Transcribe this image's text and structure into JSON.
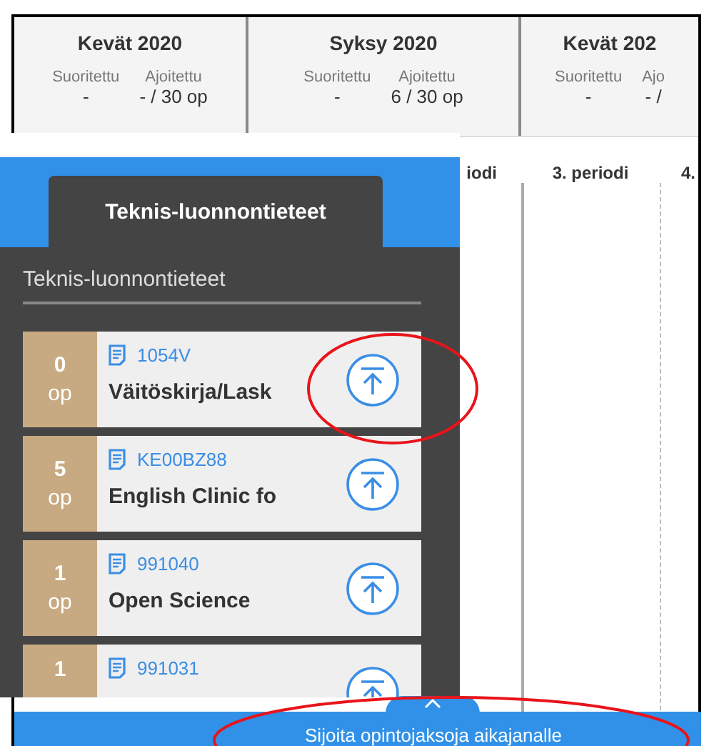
{
  "semesters": [
    {
      "title": "Kevät 2020",
      "stats": [
        {
          "label": "Suoritettu",
          "value": "-"
        },
        {
          "label": "Ajoitettu",
          "value": "- / 30 op"
        }
      ]
    },
    {
      "title": "Syksy 2020",
      "stats": [
        {
          "label": "Suoritettu",
          "value": "-"
        },
        {
          "label": "Ajoitettu",
          "value": "6 / 30 op"
        }
      ]
    },
    {
      "title": "Kevät 202",
      "stats": [
        {
          "label": "Suoritettu",
          "value": "-"
        },
        {
          "label": "Ajo",
          "value": "- /"
        }
      ]
    }
  ],
  "periods": [
    "iodi",
    "3. periodi",
    "4."
  ],
  "panel": {
    "tab": "Teknis-luonnontieteet",
    "heading": "Teknis-luonnontieteet",
    "courses": [
      {
        "credits": "0",
        "unit": "op",
        "code": "1054V",
        "name": "Väitöskirja/Lask"
      },
      {
        "credits": "5",
        "unit": "op",
        "code": "KE00BZ88",
        "name": "English Clinic fo"
      },
      {
        "credits": "1",
        "unit": "op",
        "code": "991040",
        "name": "Open Science"
      },
      {
        "credits": "1",
        "code": "991031"
      }
    ]
  },
  "bottom_bar": {
    "label": "Sijoita opintojaksoja aikajanalle"
  }
}
